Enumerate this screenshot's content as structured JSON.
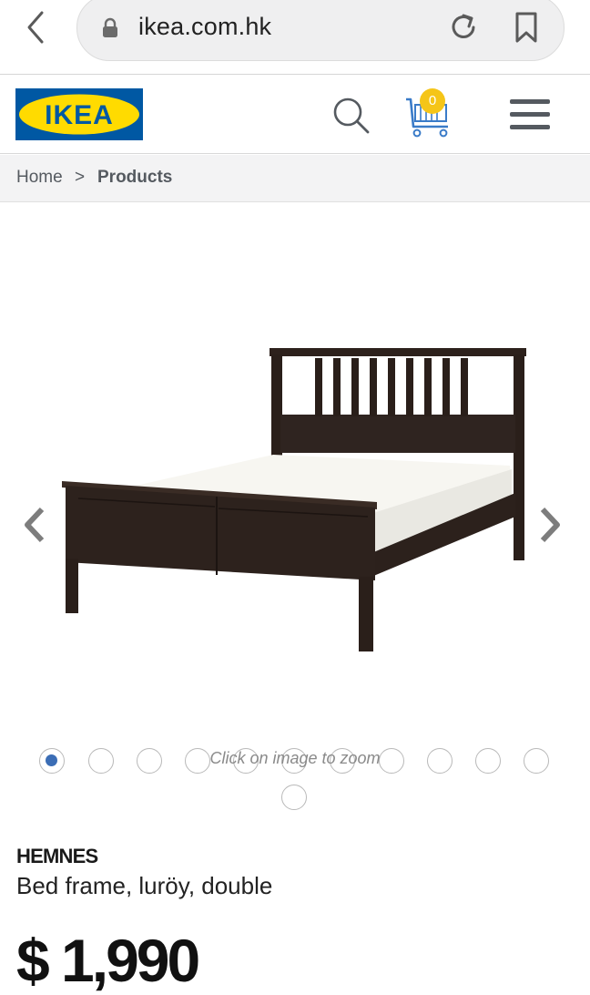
{
  "browser": {
    "url": "ikea.com.hk"
  },
  "header": {
    "logo_text": "IKEA",
    "cart_count": "0",
    "colors": {
      "logo_blue": "#0058a3",
      "logo_yellow": "#ffdb00",
      "badge": "#f5c518"
    }
  },
  "breadcrumb": {
    "home": "Home",
    "separator": ">",
    "current": "Products"
  },
  "gallery": {
    "zoom_hint": "Click on image to zoom",
    "image_count": 11,
    "active_index": 0
  },
  "product": {
    "name": "HEMNES",
    "description": "Bed frame, luröy, double",
    "price": "$ 1,990"
  },
  "icons": [
    "back-icon",
    "lock-icon",
    "reload-icon",
    "bookmark-icon",
    "search-icon",
    "cart-icon",
    "menu-icon",
    "chevron-left-icon",
    "chevron-right-icon"
  ]
}
